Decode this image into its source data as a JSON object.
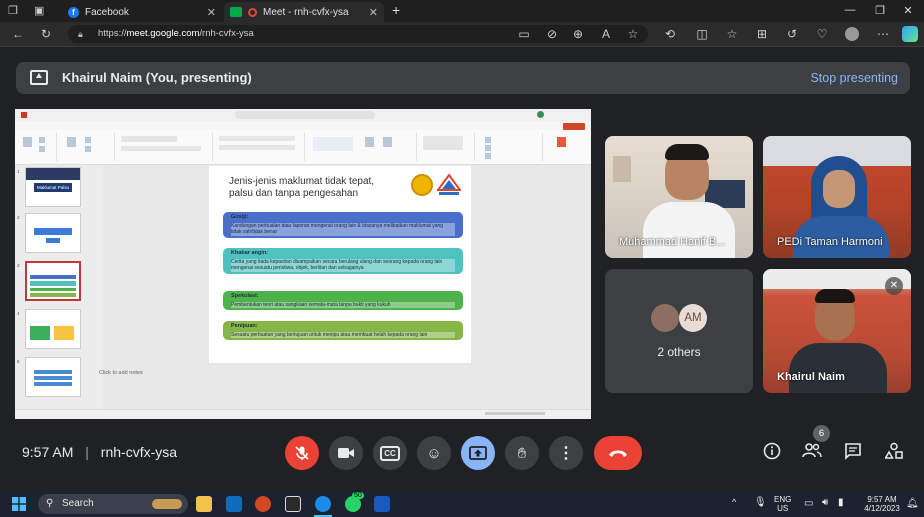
{
  "browser": {
    "tabs": [
      {
        "title": "Facebook",
        "icon": "facebook-icon"
      },
      {
        "title": "Meet - rnh-cvfx-ysa",
        "icon": "google-meet-icon"
      }
    ],
    "url": {
      "scheme": "https://",
      "domain": "meet.google.com",
      "path": "/rnh-cvfx-ysa"
    }
  },
  "banner": {
    "presenter": "Khairul Naim (You, presenting)",
    "stop_label": "Stop presenting"
  },
  "presentation": {
    "title_line1": "Jenis-jenis maklumat tidak tepat,",
    "title_line2": "palsu dan tanpa pengesahan",
    "items": [
      {
        "title": "Gosip:",
        "body": "Kandungan perbualan atau laporan mengenai orang lain & biasanya melibatkan maklumat yang tidak sah/tidak benar",
        "color": "#4a6fc9"
      },
      {
        "title": "Khabar angin:",
        "body": "Cerita yang tiada kepastian disampaikan secara berulang ulang dan seorang kepada orang lain mengenai sesuatu peristiwa, objek, berlitan dan sebagainya",
        "color": "#4fc1bf"
      },
      {
        "title": "Spekulasi:",
        "body": "Pembentukan teori atau sangkaan semata-mata tanpa bukti yang kukuh",
        "color": "#4fb34d"
      },
      {
        "title": "Penipuan:",
        "body": "Sesuatu perbuatan yang bertujuan untuk menipu atau membuat helah kepada orang lain",
        "color": "#86b64a"
      }
    ],
    "notes_placeholder": "Click to add notes",
    "thumb_numbers": [
      "1",
      "2",
      "3",
      "4",
      "5"
    ],
    "thumb1_title": "Maklumat Palsu"
  },
  "participants": [
    {
      "name": "Muhammad Hanif B..."
    },
    {
      "name": "PEDi Taman Harmoni"
    },
    {
      "name": "2 others",
      "avatar_initials": "AM"
    },
    {
      "name": "Khairul Naim"
    }
  ],
  "meeting": {
    "time": "9:57 AM",
    "code": "rnh-cvfx-ysa",
    "participant_count": "6"
  },
  "taskbar": {
    "search_label": "Search",
    "whatsapp_badge": "50",
    "lang": "ENG",
    "region": "US",
    "clock_time": "9:57 AM",
    "clock_date": "4/12/2023"
  },
  "colors": {
    "bg": "#202124",
    "accent_blue": "#8ab4f8",
    "danger_red": "#ea4335"
  }
}
